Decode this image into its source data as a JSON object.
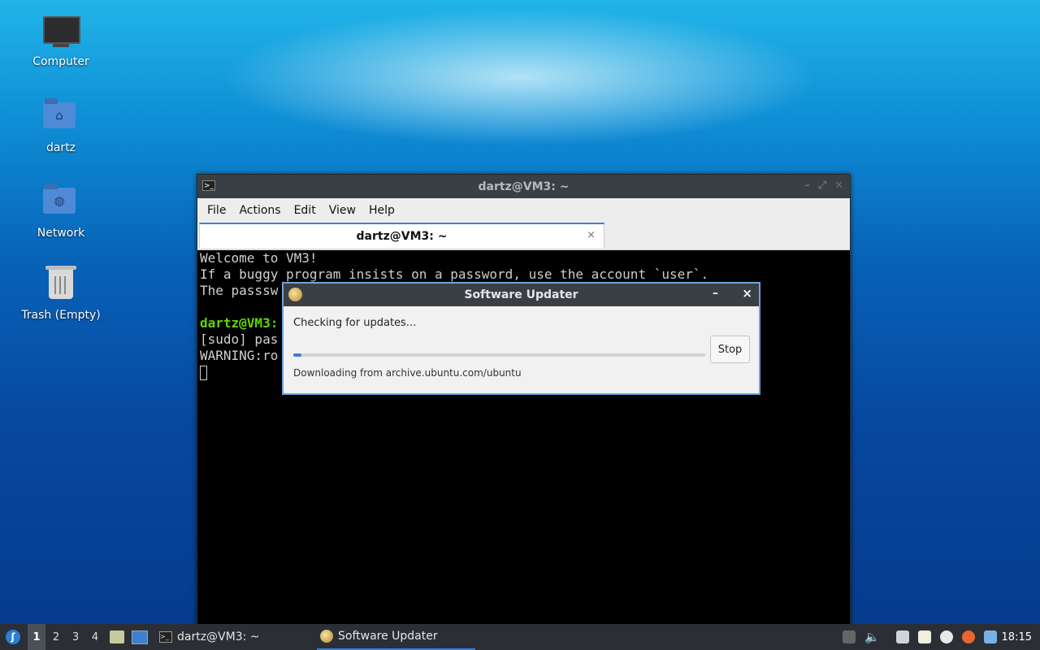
{
  "desktop": {
    "icons": [
      {
        "label": "Computer"
      },
      {
        "label": "dartz"
      },
      {
        "label": "Network"
      },
      {
        "label": "Trash (Empty)"
      }
    ]
  },
  "terminal": {
    "title": "dartz@VM3: ~",
    "menu": [
      "File",
      "Actions",
      "Edit",
      "View",
      "Help"
    ],
    "tab_label": "dartz@VM3: ~",
    "tab_close": "×",
    "lines": {
      "l1": "Welcome to VM3!",
      "l2": "If a buggy program insists on a password, use the account `user`.",
      "l3": "The passsw",
      "l4_prompt": "dartz@VM3:",
      "l5": "[sudo] pas",
      "l6": "WARNING:ro"
    }
  },
  "updater": {
    "title": "Software Updater",
    "status": "Checking for updates...",
    "progress": 0.02,
    "stop_label": "Stop",
    "detail": "Downloading from archive.ubuntu.com/ubuntu",
    "minimize": "–",
    "close": "×"
  },
  "taskbar": {
    "workspaces": [
      "1",
      "2",
      "3",
      "4"
    ],
    "tasks": [
      {
        "label": "dartz@VM3: ~"
      },
      {
        "label": "Software Updater"
      }
    ],
    "clock": "18:15",
    "accent": "#3b7dd8"
  }
}
